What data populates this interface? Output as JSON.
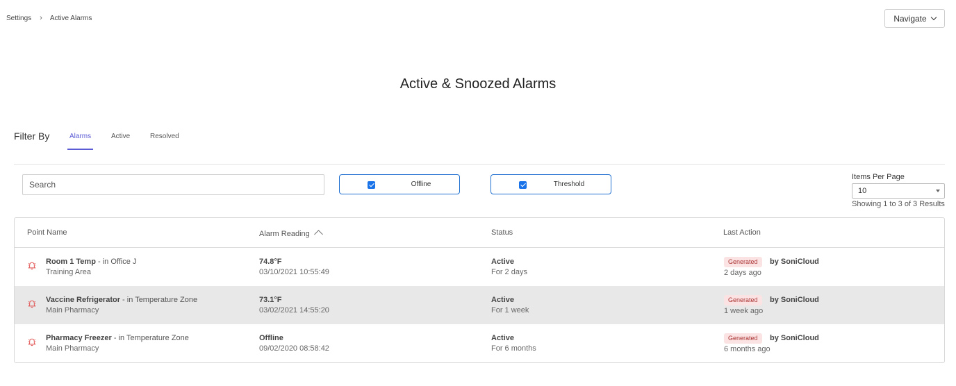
{
  "breadcrumb": {
    "parent": "Settings",
    "current": "Active Alarms"
  },
  "navigate_label": "Navigate",
  "page_title": "Active & Snoozed Alarms",
  "filter": {
    "label": "Filter By",
    "tabs": [
      "Alarms",
      "Active",
      "Resolved"
    ],
    "active_tab": "Alarms"
  },
  "search": {
    "placeholder": "Search",
    "value": ""
  },
  "toggles": [
    {
      "label": "Offline",
      "checked": true
    },
    {
      "label": "Threshold",
      "checked": true
    }
  ],
  "pagination": {
    "label": "Items Per Page",
    "selected": "10",
    "summary": "Showing 1 to 3 of 3 Results"
  },
  "table": {
    "columns": [
      "Point Name",
      "Alarm Reading",
      "Status",
      "Last Action"
    ],
    "sorted_column": "Alarm Reading",
    "rows": [
      {
        "point": "Room 1 Temp",
        "location": " - in Office J",
        "area": "Training Area",
        "reading": "74.8°F",
        "reading_time": "03/10/2021 10:55:49",
        "status": "Active",
        "duration": "For 2 days",
        "action_badge": "Generated",
        "action_by": "by SoniCloud",
        "action_ago": "2 days ago"
      },
      {
        "point": "Vaccine Refrigerator",
        "location": " - in Temperature Zone",
        "area": "Main Pharmacy",
        "reading": "73.1°F",
        "reading_time": "03/02/2021 14:55:20",
        "status": "Active",
        "duration": "For 1 week",
        "action_badge": "Generated",
        "action_by": "by SoniCloud",
        "action_ago": "1 week ago"
      },
      {
        "point": "Pharmacy Freezer",
        "location": " - in Temperature Zone",
        "area": "Main Pharmacy",
        "reading": "Offline",
        "reading_time": "09/02/2020 08:58:42",
        "status": "Active",
        "duration": "For 6 months",
        "action_badge": "Generated",
        "action_by": "by SoniCloud",
        "action_ago": "6 months ago"
      }
    ]
  },
  "colors": {
    "accent": "#5b5bd6",
    "toggle_border": "#1f6fd1",
    "alarm_icon": "#e04a4a",
    "badge_bg": "#fbe3e3",
    "badge_text": "#aa3333",
    "highlight_row": "#e8e8e8"
  },
  "icons": {
    "breadcrumb_separator": "chevron-right-icon",
    "navigate": "chevron-down-icon",
    "row_icon": "alarm-bell-icon",
    "sort": "sort-caret-up-icon"
  }
}
